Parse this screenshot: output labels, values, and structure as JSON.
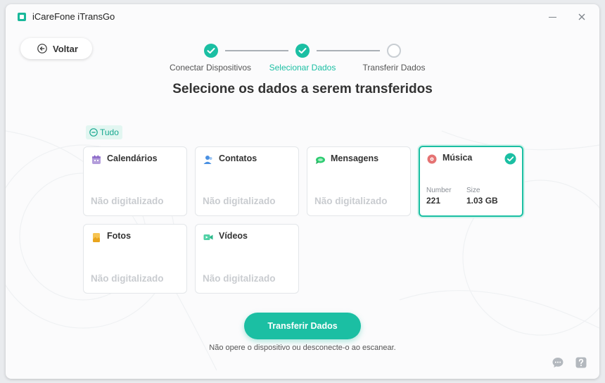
{
  "app": {
    "title": "iCareFone iTransGo"
  },
  "header": {
    "back_label": "Voltar"
  },
  "stepper": {
    "steps": [
      {
        "label": "Conectar Dispositivos",
        "state": "done"
      },
      {
        "label": "Selecionar Dados",
        "state": "active"
      },
      {
        "label": "Transferir Dados",
        "state": "todo"
      }
    ]
  },
  "main": {
    "title": "Selecione os dados a serem transferidos",
    "select_all_label": "Tudo",
    "cards": [
      {
        "label": "Calendários",
        "status": "Não digitalizado",
        "icon": "calendar-icon"
      },
      {
        "label": "Contatos",
        "status": "Não digitalizado",
        "icon": "contacts-icon"
      },
      {
        "label": "Mensagens",
        "status": "Não digitalizado",
        "icon": "messages-icon"
      },
      {
        "label": "Música",
        "icon": "music-icon",
        "selected": true,
        "number_label": "Number",
        "number_value": "221",
        "size_label": "Size",
        "size_value": "1.03 GB"
      },
      {
        "label": "Fotos",
        "status": "Não digitalizado",
        "icon": "photos-icon"
      },
      {
        "label": "Vídeos",
        "status": "Não digitalizado",
        "icon": "videos-icon"
      }
    ],
    "transfer_button": "Transferir Dados",
    "hint": "Não opere o dispositivo ou desconecte-o ao escanear."
  },
  "colors": {
    "accent": "#1bbfa3",
    "disabled_text": "#c9ccd0"
  }
}
